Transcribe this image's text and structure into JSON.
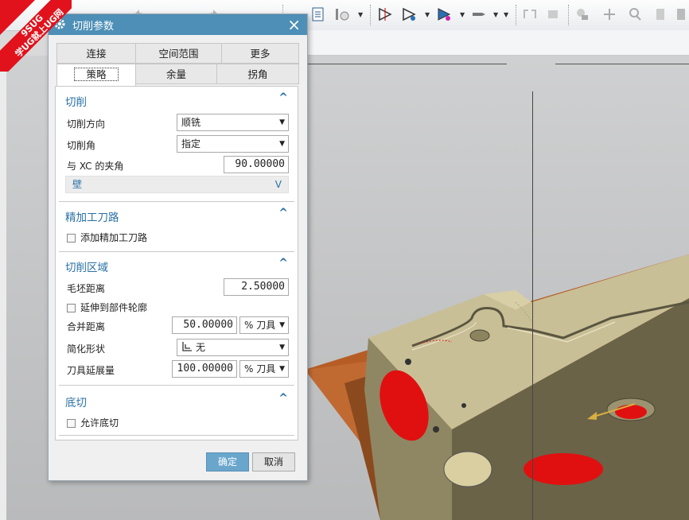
{
  "watermark": {
    "line1": "9SUG",
    "line2": "学UG就上UG网"
  },
  "toolbar": {
    "icons": [
      "undo-icon",
      "redo-icon",
      "report-icon",
      "clock-icon",
      "move-point-icon",
      "path-icon",
      "path-play-icon",
      "tool-icon",
      "transform-icon",
      "feature-icon",
      "add-icon",
      "search-icon",
      "layer-icon"
    ]
  },
  "dialog": {
    "title": "切削参数",
    "close": "×",
    "tabs_top": [
      "连接",
      "空间范围",
      "更多"
    ],
    "tabs_bottom": [
      "策略",
      "余量",
      "拐角"
    ],
    "active_tab": "策略",
    "sections": {
      "cut": {
        "title": "切削",
        "caret": "^",
        "direction_label": "切削方向",
        "direction_value": "顺铣",
        "angle_label": "切削角",
        "angle_value": "指定",
        "xc_angle_label": "与 XC 的夹角",
        "xc_angle_value": "90.00000",
        "wall_label": "壁",
        "wall_caret": "V"
      },
      "finish": {
        "title": "精加工刀路",
        "caret": "^",
        "add_finish_label": "添加精加工刀路"
      },
      "region": {
        "title": "切削区域",
        "caret": "^",
        "blank_distance_label": "毛坯距离",
        "blank_distance_value": "2.50000",
        "extend_label": "延伸到部件轮廓",
        "merge_distance_label": "合并距离",
        "merge_distance_value": "50.00000",
        "merge_unit": "% 刀具",
        "simplify_label": "简化形状",
        "simplify_value": "无",
        "extend_tool_label": "刀具延展量",
        "extend_tool_value": "100.00000",
        "extend_tool_unit": "% 刀具"
      },
      "undercut": {
        "title": "底切",
        "caret": "^",
        "allow_label": "允许底切"
      }
    },
    "ok_label": "确定",
    "cancel_label": "取消"
  },
  "colors": {
    "titlebar": "#4d8fb6",
    "section_heading": "#2970a5",
    "ok_button": "#6aa6cc",
    "part_body": "#c9bf96",
    "base_plate": "#c06a32",
    "hole_red": "#e01010"
  }
}
